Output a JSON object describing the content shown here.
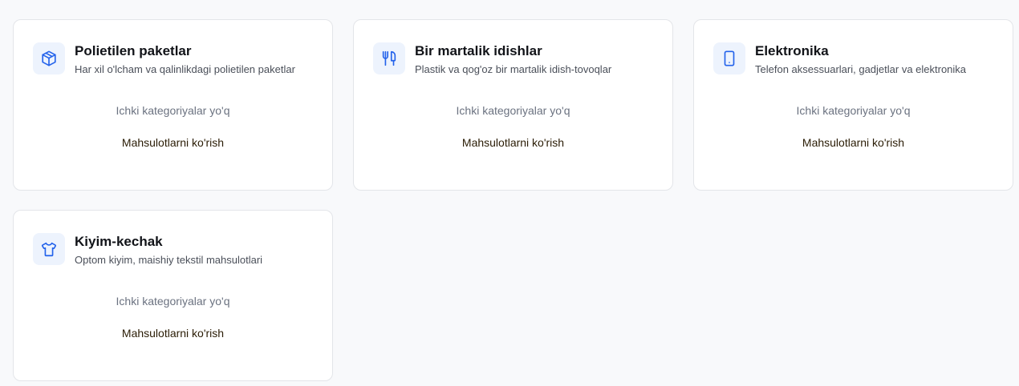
{
  "categories": [
    {
      "title": "Polietilen paketlar",
      "description": "Har xil o'lcham va qalinlikdagi polietilen paketlar",
      "icon": "package-icon",
      "empty_note": "Ichki kategoriyalar yo'q",
      "link_label": "Mahsulotlarni ko'rish"
    },
    {
      "title": "Bir martalik idishlar",
      "description": "Plastik va qog'oz bir martalik idish-tovoqlar",
      "icon": "utensils-icon",
      "empty_note": "Ichki kategoriyalar yo'q",
      "link_label": "Mahsulotlarni ko'rish"
    },
    {
      "title": "Elektronika",
      "description": "Telefon aksessuarlari, gadjetlar va elektronika",
      "icon": "smartphone-icon",
      "empty_note": "Ichki kategoriyalar yo'q",
      "link_label": "Mahsulotlarni ko'rish"
    },
    {
      "title": "Kiyim-kechak",
      "description": "Optom kiyim, maishiy tekstil mahsulotlari",
      "icon": "shirt-icon",
      "empty_note": "Ichki kategoriyalar yo'q",
      "link_label": "Mahsulotlarni ko'rish"
    }
  ],
  "colors": {
    "accent": "#2463eb",
    "icon_bg": "#edf3fd",
    "link_text": "#2a1c05"
  }
}
